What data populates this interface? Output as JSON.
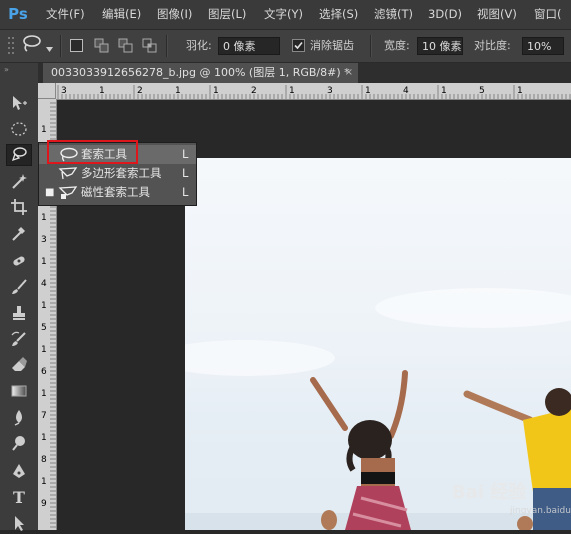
{
  "app": {
    "logo": "Ps"
  },
  "menu": [
    {
      "label": "文件(F)"
    },
    {
      "label": "编辑(E)"
    },
    {
      "label": "图像(I)"
    },
    {
      "label": "图层(L)"
    },
    {
      "label": "文字(Y)"
    },
    {
      "label": "选择(S)"
    },
    {
      "label": "滤镜(T)"
    },
    {
      "label": "3D(D)"
    },
    {
      "label": "视图(V)"
    },
    {
      "label": "窗口("
    }
  ],
  "options": {
    "feather_label": "羽化:",
    "feather_value": "0 像素",
    "antialias_label": "消除锯齿",
    "antialias_checked": true,
    "width_label": "宽度:",
    "width_value": "10 像素",
    "contrast_label": "对比度:",
    "contrast_value": "10%"
  },
  "document": {
    "tab_title": "0033033912656278_b.jpg @ 100% (图层 1, RGB/8#) *",
    "close": "×"
  },
  "ruler": {
    "h_ticks": [
      "3",
      "1",
      "2",
      "1",
      "1",
      "2",
      "1",
      "3",
      "1",
      "4",
      "1",
      "5",
      "1"
    ],
    "v_ticks": [
      "1",
      "1",
      "1",
      "2",
      "1",
      "3",
      "1",
      "4",
      "1",
      "5",
      "1",
      "6",
      "1",
      "7",
      "1",
      "8",
      "1",
      "9"
    ]
  },
  "flyout": {
    "items": [
      {
        "label": "套索工具",
        "shortcut": "L",
        "icon": "lasso-icon",
        "active": true
      },
      {
        "label": "多边形套索工具",
        "shortcut": "L",
        "icon": "polygon-lasso-icon",
        "active": false
      },
      {
        "label": "磁性套索工具",
        "shortcut": "L",
        "icon": "magnetic-lasso-icon",
        "active": false
      }
    ]
  },
  "tools": [
    "move-icon",
    "marquee-icon",
    "lasso-icon",
    "magic-wand-icon",
    "crop-icon",
    "eyedropper-icon",
    "healing-icon",
    "brush-icon",
    "stamp-icon",
    "history-brush-icon",
    "eraser-icon",
    "gradient-icon",
    "blur-icon",
    "dodge-icon",
    "pen-icon",
    "type-icon",
    "path-select-icon"
  ],
  "watermark": {
    "text": "Bai 经验",
    "sub": "jingyan.baidu.com"
  },
  "colors": {
    "accent_red": "#e0161d",
    "ps_blue": "#4aa3e8"
  }
}
